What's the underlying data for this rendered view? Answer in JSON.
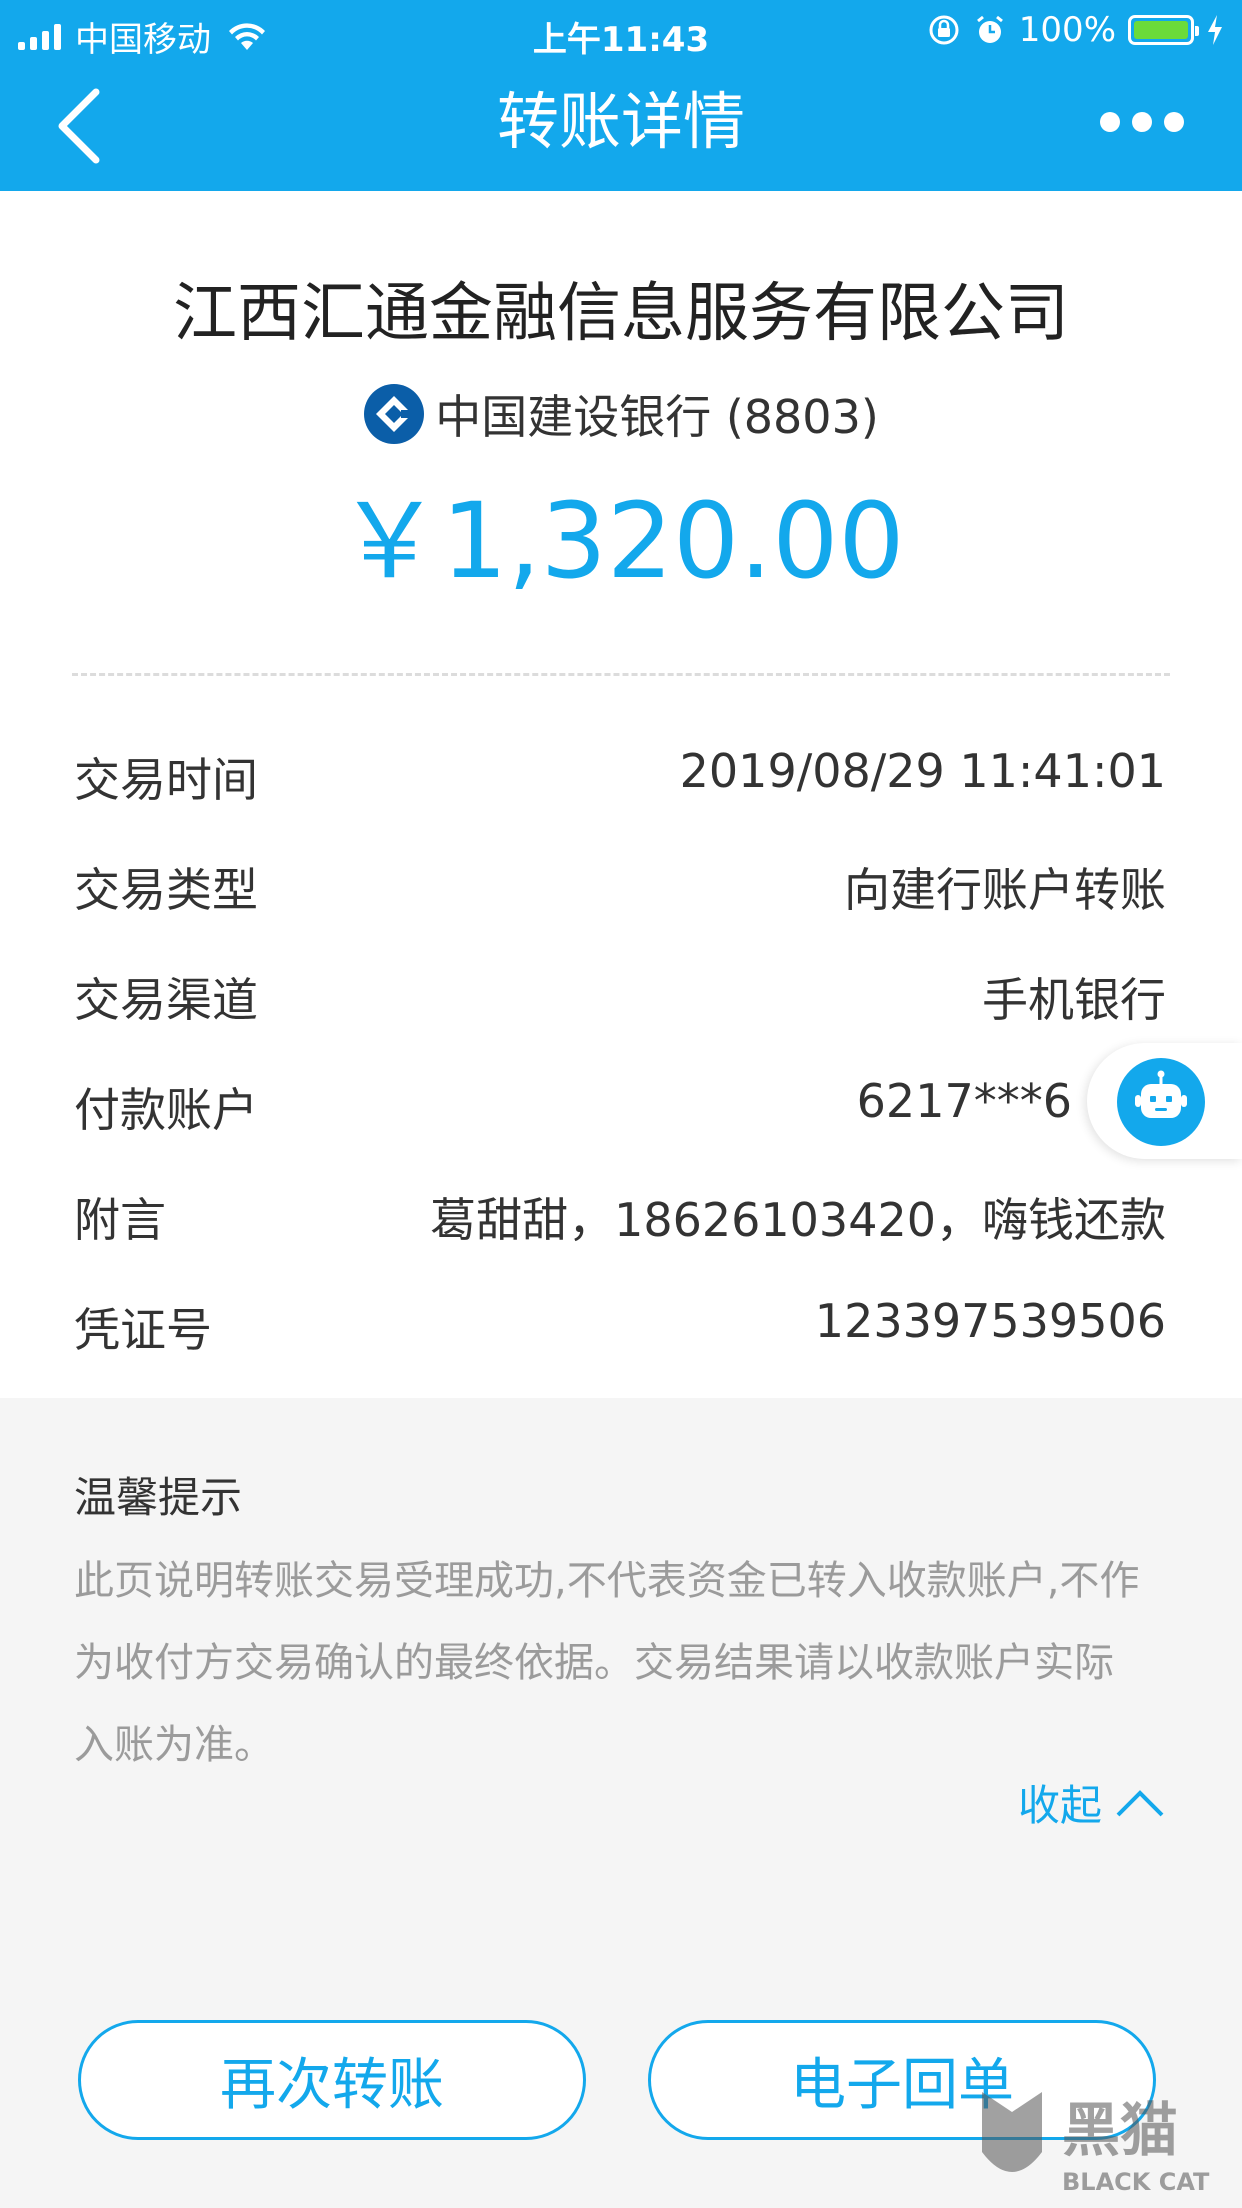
{
  "status_bar": {
    "carrier": "中国移动",
    "time": "上午11:43",
    "battery": "100%"
  },
  "header": {
    "title": "转账详情"
  },
  "summary": {
    "payee": "江西汇通金融信息服务有限公司",
    "bank": "中国建设银行 (8803)",
    "amount": "￥1,320.00"
  },
  "details": [
    {
      "label": "交易时间",
      "value": "2019/08/29 11:41:01"
    },
    {
      "label": "交易类型",
      "value": "向建行账户转账"
    },
    {
      "label": "交易渠道",
      "value": "手机银行"
    },
    {
      "label": "付款账户",
      "value": "6217***6"
    },
    {
      "label": "附言",
      "value": "葛甜甜，18626103420，嗨钱还款"
    },
    {
      "label": "凭证号",
      "value": "123397539506"
    }
  ],
  "tips": {
    "title": "温馨提示",
    "lines": [
      "此页说明转账交易受理成功,不代表资金已转入收款账户,不作",
      "为收付方交易确认的最终依据。交易结果请以收款账户实际",
      "入账为准。"
    ],
    "collapse_label": "收起"
  },
  "buttons": {
    "transfer_again": "再次转账",
    "receipt": "电子回单"
  },
  "watermark": {
    "text_cn": "黑猫",
    "text_en": "BLACK CAT"
  },
  "colors": {
    "accent": "#13a8ec",
    "battery": "#6bdb3a"
  }
}
